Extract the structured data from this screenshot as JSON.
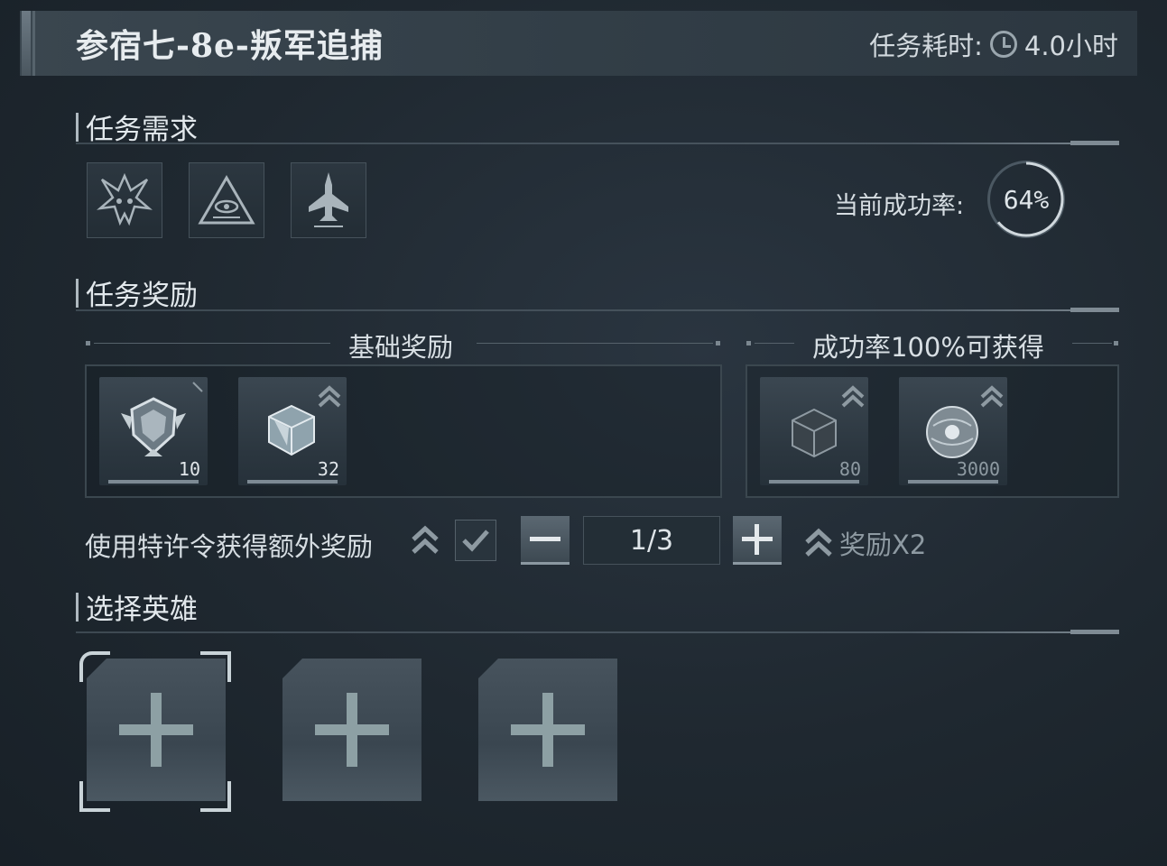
{
  "header": {
    "mission_title": "参宿七-8e-叛军追捕",
    "duration_label": "任务耗时:",
    "duration_value": "4.0小时",
    "clock_icon": "clock-icon"
  },
  "requirements": {
    "title": "任务需求",
    "icons": [
      "demon-emblem-icon",
      "eye-pyramid-icon",
      "fighter-jet-icon"
    ],
    "success_rate_label": "当前成功率:",
    "success_rate_value": "64%",
    "success_rate_fraction": 0.64
  },
  "rewards": {
    "title": "任务奖励",
    "base_title": "基础奖励",
    "bonus_title": "成功率100%可获得",
    "base_items": [
      {
        "icon": "rank-badge-icon",
        "count": "10"
      },
      {
        "icon": "crystal-cube-icon",
        "count": "32"
      }
    ],
    "bonus_items": [
      {
        "icon": "dark-cube-icon",
        "count": "80"
      },
      {
        "icon": "orb-icon",
        "count": "3000"
      }
    ]
  },
  "privilege": {
    "label": "使用特许令获得额外奖励",
    "checked": true,
    "minus_label": "−",
    "plus_label": "+",
    "stepper_value": "1/3",
    "bonus_text": "奖励X2"
  },
  "heroes": {
    "title": "选择英雄",
    "slots": 3
  },
  "colors": {
    "background": "#1f2830",
    "accent": "#aeb8bf",
    "plus": "#8da0a4"
  }
}
